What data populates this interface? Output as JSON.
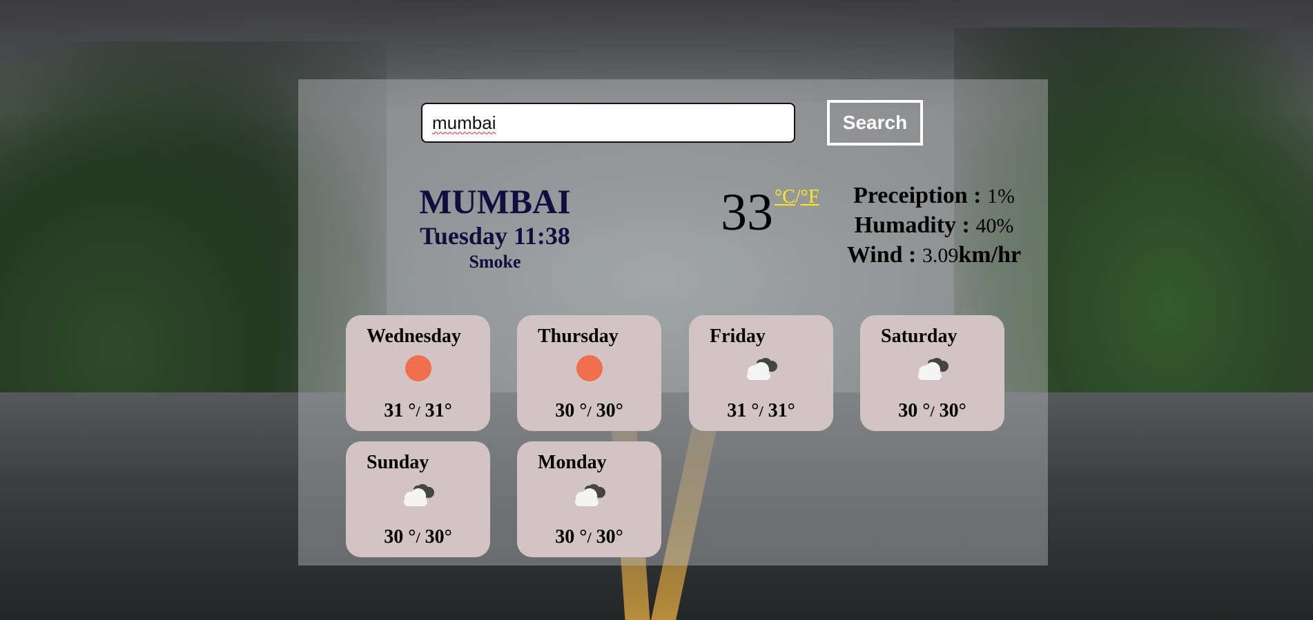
{
  "search": {
    "value": "mumbai",
    "button_label": "Search"
  },
  "current": {
    "city": "MUMBAI",
    "datetime": "Tuesday 11:38",
    "description": "Smoke",
    "temperature": "33",
    "unit_celsius": "°C",
    "unit_separator": "/",
    "unit_fahrenheit": "°F",
    "precipitation_label": "Preceiption : ",
    "precipitation_value": "1%",
    "humidity_label": "Humadity : ",
    "humidity_value": "40%",
    "wind_label": "Wind : ",
    "wind_value": "3.09",
    "wind_unit": "km/hr"
  },
  "forecast": [
    {
      "day": "Wednesday",
      "icon": "sun-icon",
      "high": "31 °",
      "sep": "/",
      "low": " 31°"
    },
    {
      "day": "Thursday",
      "icon": "sun-icon",
      "high": "30 °",
      "sep": "/",
      "low": " 30°"
    },
    {
      "day": "Friday",
      "icon": "cloud-icon",
      "high": "31 °",
      "sep": "/",
      "low": " 31°"
    },
    {
      "day": "Saturday",
      "icon": "cloud-icon",
      "high": "30 °",
      "sep": "/",
      "low": " 30°"
    },
    {
      "day": "Sunday",
      "icon": "cloud-icon",
      "high": "30 °",
      "sep": "/",
      "low": " 30°"
    },
    {
      "day": "Monday",
      "icon": "cloud-icon",
      "high": "30 °",
      "sep": "/",
      "low": " 30°"
    }
  ],
  "colors": {
    "city_text": "#140c3e",
    "unit_link": "#ffeb1a",
    "card_bg": "#d2c4c4",
    "sun": "#ef6e4b"
  }
}
